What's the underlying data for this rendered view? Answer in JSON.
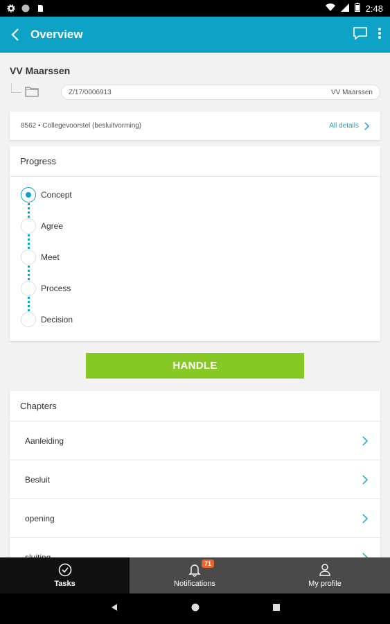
{
  "status_bar": {
    "time": "2:48"
  },
  "app_bar": {
    "title": "Overview"
  },
  "case": {
    "name": "VV Maarssen",
    "number": "Z/17/0006913",
    "organization": "VV Maarssen"
  },
  "summary": {
    "text": "8562 • Collegevoorstel (besluitvorming)",
    "details_label": "All details"
  },
  "progress": {
    "heading": "Progress",
    "steps": [
      {
        "label": "Concept",
        "active": true
      },
      {
        "label": "Agree",
        "active": false
      },
      {
        "label": "Meet",
        "active": false
      },
      {
        "label": "Process",
        "active": false
      },
      {
        "label": "Decision",
        "active": false
      }
    ]
  },
  "handle_label": "HANDLE",
  "chapters": {
    "heading": "Chapters",
    "items": [
      {
        "label": "Aanleiding"
      },
      {
        "label": "Besluit"
      },
      {
        "label": "opening"
      },
      {
        "label": "sluiting"
      }
    ]
  },
  "bottom_nav": {
    "tasks": "Tasks",
    "notifications": "Notifications",
    "notifications_count": "71",
    "profile": "My profile"
  },
  "colors": {
    "accent": "#0ea3c6",
    "handle": "#86c924",
    "badge": "#e8652b"
  }
}
